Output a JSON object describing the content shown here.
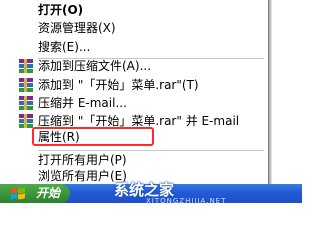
{
  "context_menu": {
    "items": [
      {
        "label": "打开(O)",
        "icon": "",
        "bold": true
      },
      {
        "label": "资源管理器(X)",
        "icon": ""
      },
      {
        "label": "搜索(E)...",
        "icon": ""
      },
      {
        "label": "添加到压缩文件(A)...",
        "icon": "winrar-archive-icon"
      },
      {
        "label": "添加到 \"「开始」菜单.rar\"(T)",
        "icon": "winrar-archive-icon"
      },
      {
        "label": "压缩并 E-mail...",
        "icon": "winrar-archive-icon"
      },
      {
        "label": "压缩到 \"「开始」菜单.rar\" 并 E-mail",
        "icon": "winrar-archive-icon"
      },
      {
        "label": "属性(R)",
        "icon": "",
        "highlighted": true
      },
      {
        "label": "打开所有用户(P)",
        "icon": ""
      },
      {
        "label": "浏览所有用户(E)",
        "icon": ""
      }
    ],
    "highlight_color": "#ff2a2a"
  },
  "taskbar": {
    "start_label": "开始",
    "color": "#2459d6",
    "start_color": "#3c963c"
  },
  "watermark": {
    "text": "系统之家",
    "sub": "XITONGZHIJIA.NET"
  }
}
